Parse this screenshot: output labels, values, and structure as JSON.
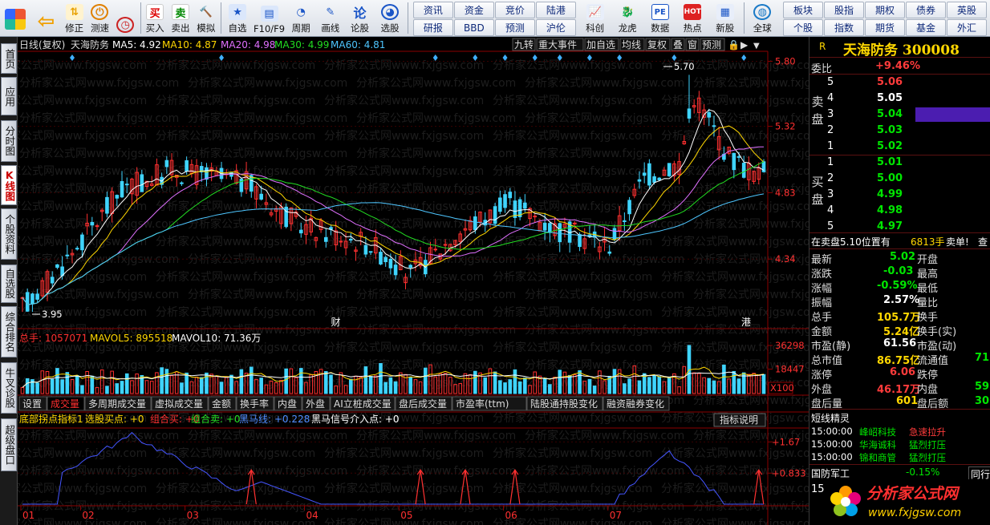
{
  "toolbar": {
    "buttons": [
      {
        "label": "",
        "icon": "apps-icon"
      },
      {
        "label": "",
        "icon": "back-arrow-icon"
      },
      {
        "label": "修正",
        "icon": "up-down-icon"
      },
      {
        "label": "测速",
        "icon": "power-icon"
      },
      {
        "label": "",
        "icon": "clock-icon"
      },
      {
        "label": "买入",
        "icon": "buy-icon"
      },
      {
        "label": "卖出",
        "icon": "sell-icon"
      },
      {
        "label": "模拟",
        "icon": "gavel-icon"
      },
      {
        "label": "自选",
        "icon": "star-icon"
      },
      {
        "label": "F10/F9",
        "icon": "f10-icon"
      },
      {
        "label": "周期",
        "icon": "period-icon"
      },
      {
        "label": "画线",
        "icon": "pencil-icon"
      },
      {
        "label": "论股",
        "icon": "discuss-icon"
      },
      {
        "label": "选股",
        "icon": "gauge-icon"
      }
    ],
    "grid1": [
      "资讯",
      "资金",
      "竞价",
      "陆港",
      "研报",
      "BBD",
      "预测",
      "沪伦"
    ],
    "icons2": [
      {
        "label": "科创",
        "icon": "chart-icon"
      },
      {
        "label": "龙虎",
        "icon": "dragon-icon"
      },
      {
        "label": "数据",
        "icon": "pe-icon"
      },
      {
        "label": "热点",
        "icon": "hot-icon"
      },
      {
        "label": "新股",
        "icon": "ipo-icon"
      },
      {
        "label": "全球",
        "icon": "globe-icon"
      }
    ],
    "grid2": [
      "板块",
      "股指",
      "期权",
      "债券",
      "英股",
      "个股",
      "指数",
      "期货",
      "基金",
      "外汇"
    ]
  },
  "left_tabs": [
    "首页",
    "应用",
    "分时图",
    "K线图",
    "个股资料",
    "自选股",
    "综合排名",
    "牛叉诊股",
    "超级盘口"
  ],
  "chart": {
    "header": {
      "period": "日线(复权)",
      "stock": "天海防务",
      "ma5": "MA5: 4.92",
      "ma10": "MA10: 4.87",
      "ma20": "MA20: 4.98",
      "ma30": "MA30: 4.99",
      "ma60": "MA60: 4.81"
    },
    "right_buttons": [
      "九转",
      "重大事件",
      "加自选",
      "均线",
      "复权",
      "叠",
      "窗",
      "预测"
    ],
    "price_ticks": [
      "5.80",
      "5.32",
      "4.83",
      "4.34"
    ],
    "high_label": "5.70",
    "low_label": "3.95",
    "markers": [
      "财",
      "港"
    ],
    "volume_header": {
      "total": "总手: 1057071",
      "mavol5": "MAVOL5: 895518",
      "mavol10": "MAVOL10: 71.36万"
    },
    "volume_ticks": [
      "36298",
      "18447"
    ],
    "volume_unit": "X100",
    "tabs": [
      "设置",
      "成交量",
      "多周期成交量",
      "虚拟成交量",
      "金额",
      "换手率",
      "内盘",
      "外盘",
      "AI立桩成交量",
      "盘后成交量",
      "市盈率(ttm)",
      "陆股通持股变化",
      "融资融券变化"
    ],
    "indicator_header": {
      "name": "底部拐点指标1",
      "buy": "选股买点: +0",
      "combo_buy": "组合买: +0",
      "combo_sell": "组合卖: +0",
      "black_horse": "黑马线: +0.228",
      "dark_horse": "黑马信号介入点: +0"
    },
    "indicator_button": "指标说明",
    "indicator_ticks": [
      "+1.67",
      "+0.833"
    ],
    "month_labels": [
      "01",
      "02",
      "03",
      "04",
      "05",
      "06",
      "07"
    ],
    "watermark": "分析家公式网www.fxjgsw.com"
  },
  "chart_data": {
    "type": "candlestick",
    "title": "天海防务 日线(复权)",
    "ylim": [
      3.85,
      5.85
    ],
    "categories": [
      "01",
      "02",
      "03",
      "04",
      "05",
      "06",
      "07"
    ],
    "series": [
      {
        "name": "MA5",
        "last": 4.92
      },
      {
        "name": "MA10",
        "last": 4.87
      },
      {
        "name": "MA20",
        "last": 4.98
      },
      {
        "name": "MA30",
        "last": 4.99
      },
      {
        "name": "MA60",
        "last": 4.81
      }
    ],
    "high": 5.7,
    "low": 3.95,
    "volume_ylim": [
      0,
      36298
    ]
  },
  "right_panel": {
    "header": {
      "r": "R",
      "name": "天海防务",
      "code": "300008"
    },
    "weibi": {
      "label": "委比",
      "value": "+9.46%"
    },
    "sell_label": "卖盘",
    "buy_label": "买盘",
    "asks": [
      {
        "level": "5",
        "price": "5.06"
      },
      {
        "level": "4",
        "price": "5.05"
      },
      {
        "level": "3",
        "price": "5.04"
      },
      {
        "level": "2",
        "price": "5.03"
      },
      {
        "level": "1",
        "price": "5.02"
      }
    ],
    "bids": [
      {
        "level": "1",
        "price": "5.01"
      },
      {
        "level": "2",
        "price": "5.00"
      },
      {
        "level": "3",
        "price": "4.99"
      },
      {
        "level": "4",
        "price": "4.98"
      },
      {
        "level": "5",
        "price": "4.97"
      }
    ],
    "notice": {
      "text": "在卖盘5.10位置有",
      "qty": "6813手",
      "action": "卖单!",
      "more": "查"
    },
    "stats": [
      {
        "l1": "最新",
        "v1": "5.02",
        "c1": "green",
        "l2": "开盘",
        "v2": ""
      },
      {
        "l1": "涨跌",
        "v1": "-0.03",
        "c1": "green",
        "l2": "最高",
        "v2": ""
      },
      {
        "l1": "涨幅",
        "v1": "-0.59%",
        "c1": "green",
        "l2": "最低",
        "v2": ""
      },
      {
        "l1": "振幅",
        "v1": "2.57%",
        "c1": "white",
        "l2": "量比",
        "v2": ""
      },
      {
        "l1": "总手",
        "v1": "105.7万",
        "c1": "yellow",
        "l2": "换手",
        "v2": ""
      },
      {
        "l1": "金额",
        "v1": "5.24亿",
        "c1": "yellow",
        "l2": "换手(实)",
        "v2": ""
      },
      {
        "l1": "市盈(静)",
        "v1": "61.56",
        "c1": "white",
        "l2": "市盈(动)",
        "v2": ""
      },
      {
        "l1": "总市值",
        "v1": "86.75亿",
        "c1": "yellow",
        "l2": "流通值",
        "v2": "71"
      },
      {
        "l1": "涨停",
        "v1": "6.06",
        "c1": "red",
        "l2": "跌停",
        "v2": ""
      },
      {
        "l1": "外盘",
        "v1": "46.17万",
        "c1": "red",
        "l2": "内盘",
        "v2": "59"
      },
      {
        "l1": "盘后量",
        "v1": "601",
        "c1": "yellow",
        "l2": "盘后额",
        "v2": "30"
      }
    ],
    "spirit": {
      "title": "短线精灵",
      "rows": [
        {
          "time": "15:00:00",
          "name": "峰岹科技",
          "event": "急速拉升"
        },
        {
          "time": "15:00:00",
          "name": "华海诚科",
          "event": "猛烈打压"
        },
        {
          "time": "15:00:00",
          "name": "锦和商管",
          "event": "猛烈打压"
        }
      ]
    },
    "sector": {
      "name": "国防军工",
      "change": "-0.15%",
      "peers": "同行业"
    },
    "footer_num": "15"
  },
  "logo": {
    "text": "分析家公式网",
    "url": "www.fxjgsw.com"
  }
}
